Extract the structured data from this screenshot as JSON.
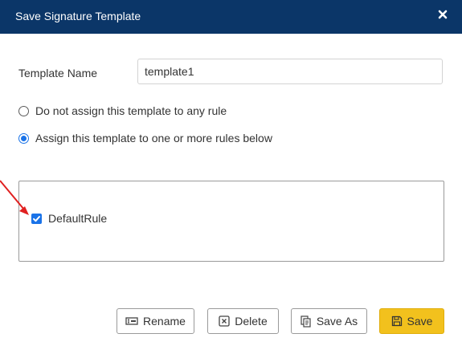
{
  "dialog": {
    "title": "Save Signature Template",
    "close_icon": "close-icon"
  },
  "form": {
    "template_name_label": "Template Name",
    "template_name_value": "template1"
  },
  "assignment": {
    "options": [
      {
        "label": "Do not assign this template to any rule",
        "selected": false
      },
      {
        "label": "Assign this template to one or more rules below",
        "selected": true
      }
    ]
  },
  "rules": {
    "items": [
      {
        "label": "DefaultRule",
        "checked": true
      }
    ]
  },
  "buttons": {
    "rename": "Rename",
    "delete": "Delete",
    "save_as": "Save As",
    "save": "Save"
  },
  "colors": {
    "titlebar": "#0b3668",
    "accent": "#1a73e8",
    "save_button": "#f2c11d",
    "annotation_arrow": "#e02020"
  }
}
